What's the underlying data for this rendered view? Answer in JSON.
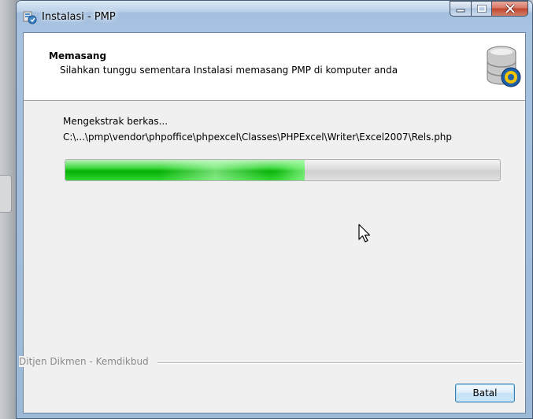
{
  "window": {
    "title": "Instalasi - PMP"
  },
  "caption_buttons": {
    "minimize_icon": "minimize-icon",
    "maximize_icon": "maximize-icon",
    "close_icon": "close-icon"
  },
  "header": {
    "title": "Memasang",
    "subtitle": "Silahkan tunggu sementara Instalasi memasang PMP di komputer anda",
    "logo_icon": "database-installer-icon"
  },
  "progress": {
    "status": "Mengekstrak berkas...",
    "current_file": "C:\\...\\pmp\\vendor\\phpoffice\\phpexcel\\Classes\\PHPExcel\\Writer\\Excel2007\\Rels.php",
    "percent": 55
  },
  "footer": {
    "branding": "Ditjen Dikmen - Kemdikbud",
    "cancel_label": "Batal"
  },
  "colors": {
    "progress_fill": "#06b006",
    "close_button": "#c0452e",
    "title_bar": "#a8c3e1"
  }
}
